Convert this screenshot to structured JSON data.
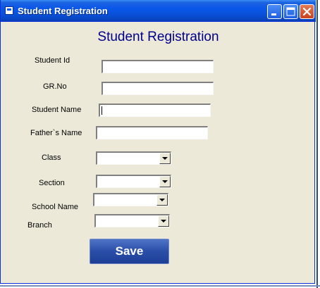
{
  "window": {
    "title": "Student Registration"
  },
  "form": {
    "heading": "Student Registration",
    "fields": {
      "student_id": {
        "label": "Student Id",
        "value": ""
      },
      "gr_no": {
        "label": "GR.No",
        "value": ""
      },
      "student_name": {
        "label": "Student Name",
        "value": ""
      },
      "father_name": {
        "label": "Father`s Name",
        "value": ""
      },
      "class": {
        "label": "Class",
        "value": ""
      },
      "section": {
        "label": "Section",
        "value": ""
      },
      "school_name": {
        "label": "School Name",
        "value": ""
      },
      "branch": {
        "label": "Branch",
        "value": ""
      }
    },
    "save_label": "Save"
  },
  "colors": {
    "titlebar": "#0a57e8",
    "window_bg": "#ece9d8",
    "heading": "#00008b",
    "save_button": "#2a4ea8",
    "close_button": "#c8421e"
  },
  "icons": {
    "app": "app-window-icon",
    "minimize": "minimize-icon",
    "maximize": "maximize-icon",
    "close": "close-icon",
    "dropdown": "chevron-down-icon"
  }
}
